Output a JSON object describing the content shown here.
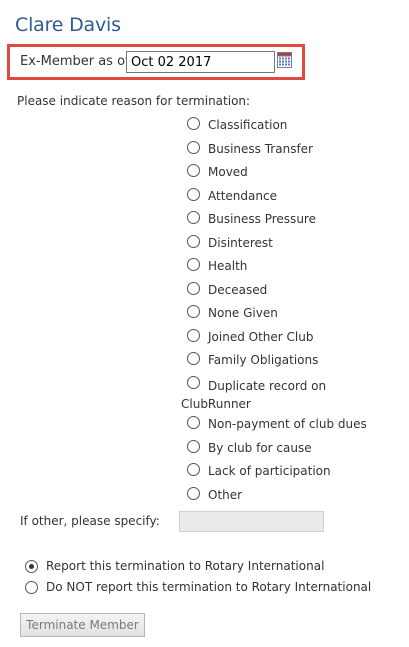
{
  "member": {
    "name": "Clare Davis"
  },
  "ex_member": {
    "label": "Ex-Member as of:",
    "date_value": "Oct 02 2017",
    "calendar_icon": "calendar-icon"
  },
  "termination": {
    "prompt": "Please indicate reason for termination:",
    "reasons": [
      {
        "label": "Classification",
        "checked": false
      },
      {
        "label": "Business Transfer",
        "checked": false
      },
      {
        "label": "Moved",
        "checked": false
      },
      {
        "label": "Attendance",
        "checked": false
      },
      {
        "label": "Business Pressure",
        "checked": false
      },
      {
        "label": "Disinterest",
        "checked": false
      },
      {
        "label": "Health",
        "checked": false
      },
      {
        "label": "Deceased",
        "checked": false
      },
      {
        "label": "None Given",
        "checked": false
      },
      {
        "label": "Joined Other Club",
        "checked": false
      },
      {
        "label": "Family Obligations",
        "checked": false
      },
      {
        "label": "Duplicate record on ClubRunner",
        "checked": false
      },
      {
        "label": "Non-payment of club dues",
        "checked": false
      },
      {
        "label": "By club for cause",
        "checked": false
      },
      {
        "label": "Lack of participation",
        "checked": false
      },
      {
        "label": "Other",
        "checked": false
      }
    ],
    "other_label": "If other, please specify:",
    "other_value": ""
  },
  "report": {
    "options": [
      {
        "label": "Report this termination to Rotary International",
        "checked": true
      },
      {
        "label": "Do NOT report this termination to Rotary International",
        "checked": false
      }
    ]
  },
  "actions": {
    "terminate_label": "Terminate Member"
  },
  "colors": {
    "title": "#2f5b8e",
    "highlight_border": "#e04a43",
    "disabled_input": "#ebebeb"
  }
}
